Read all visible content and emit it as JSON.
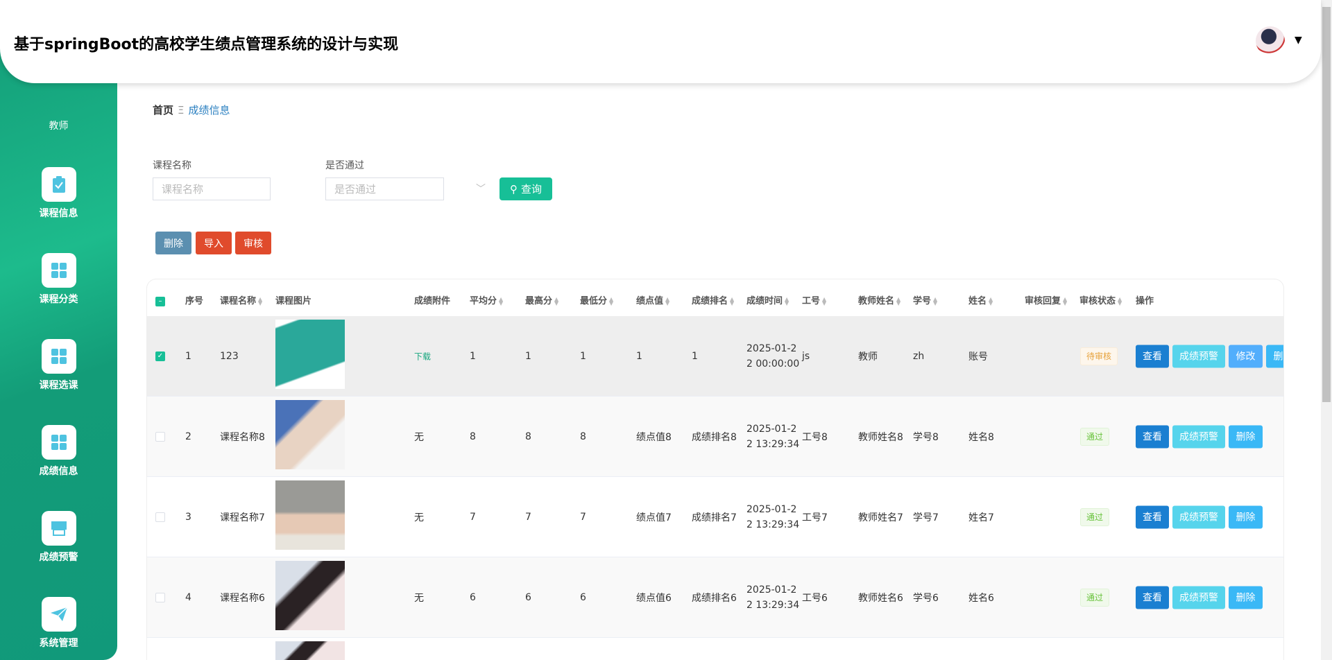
{
  "header": {
    "title": "基于springBoot的高校学生绩点管理系统的设计与实现"
  },
  "sidebar": {
    "role": "教师",
    "items": [
      {
        "label": "课程信息",
        "icon": "clipboard-check-icon"
      },
      {
        "label": "课程分类",
        "icon": "grid-icon"
      },
      {
        "label": "课程选课",
        "icon": "grid-icon"
      },
      {
        "label": "成绩信息",
        "icon": "grid-icon"
      },
      {
        "label": "成绩预警",
        "icon": "shop-icon"
      },
      {
        "label": "系统管理",
        "icon": "paper-plane-icon"
      }
    ]
  },
  "breadcrumb": {
    "home": "首页",
    "sep": "Ξ",
    "current": "成绩信息"
  },
  "search": {
    "course_label": "课程名称",
    "course_placeholder": "课程名称",
    "pass_label": "是否通过",
    "pass_placeholder": "是否通过",
    "query": "查询"
  },
  "actions": {
    "delete": "删除",
    "import": "导入",
    "audit": "审核"
  },
  "colors": {
    "accent": "#17bf97",
    "view": "#1a7fd1",
    "warn": "#56d4ec",
    "edit": "#52aefc",
    "del": "#3ab8f6",
    "pending": "#e6a23c",
    "pass": "#67c23a"
  },
  "table": {
    "columns": [
      "序号",
      "课程名称",
      "课程图片",
      "成绩附件",
      "平均分",
      "最高分",
      "最低分",
      "绩点值",
      "成绩排名",
      "成绩时间",
      "工号",
      "教师姓名",
      "学号",
      "姓名",
      "审核回复",
      "审核状态",
      "操作"
    ],
    "rows": [
      {
        "no": "1",
        "course": "123",
        "attach": "下载",
        "avg": "1",
        "max": "1",
        "min": "1",
        "gpa": "1",
        "rank": "1",
        "time1": "2025-01-2",
        "time2": "2 00:00:00",
        "tid": "js",
        "tname": "教师",
        "sid": "zh",
        "sname": "账号",
        "reply": "",
        "status": "待审核",
        "checked": true,
        "ops": [
          "查看",
          "成绩预警",
          "修改",
          "删除"
        ]
      },
      {
        "no": "2",
        "course": "课程名称8",
        "attach": "无",
        "avg": "8",
        "max": "8",
        "min": "8",
        "gpa": "绩点值8",
        "rank": "成绩排名8",
        "time1": "2025-01-2",
        "time2": "2 13:29:34",
        "tid": "工号8",
        "tname": "教师姓名8",
        "sid": "学号8",
        "sname": "姓名8",
        "reply": "",
        "status": "通过",
        "checked": false,
        "ops": [
          "查看",
          "成绩预警",
          "删除"
        ]
      },
      {
        "no": "3",
        "course": "课程名称7",
        "attach": "无",
        "avg": "7",
        "max": "7",
        "min": "7",
        "gpa": "绩点值7",
        "rank": "成绩排名7",
        "time1": "2025-01-2",
        "time2": "2 13:29:34",
        "tid": "工号7",
        "tname": "教师姓名7",
        "sid": "学号7",
        "sname": "姓名7",
        "reply": "",
        "status": "通过",
        "checked": false,
        "ops": [
          "查看",
          "成绩预警",
          "删除"
        ]
      },
      {
        "no": "4",
        "course": "课程名称6",
        "attach": "无",
        "avg": "6",
        "max": "6",
        "min": "6",
        "gpa": "绩点值6",
        "rank": "成绩排名6",
        "time1": "2025-01-2",
        "time2": "2 13:29:34",
        "tid": "工号6",
        "tname": "教师姓名6",
        "sid": "学号6",
        "sname": "姓名6",
        "reply": "",
        "status": "通过",
        "checked": false,
        "ops": [
          "查看",
          "成绩预警",
          "删除"
        ]
      }
    ]
  }
}
